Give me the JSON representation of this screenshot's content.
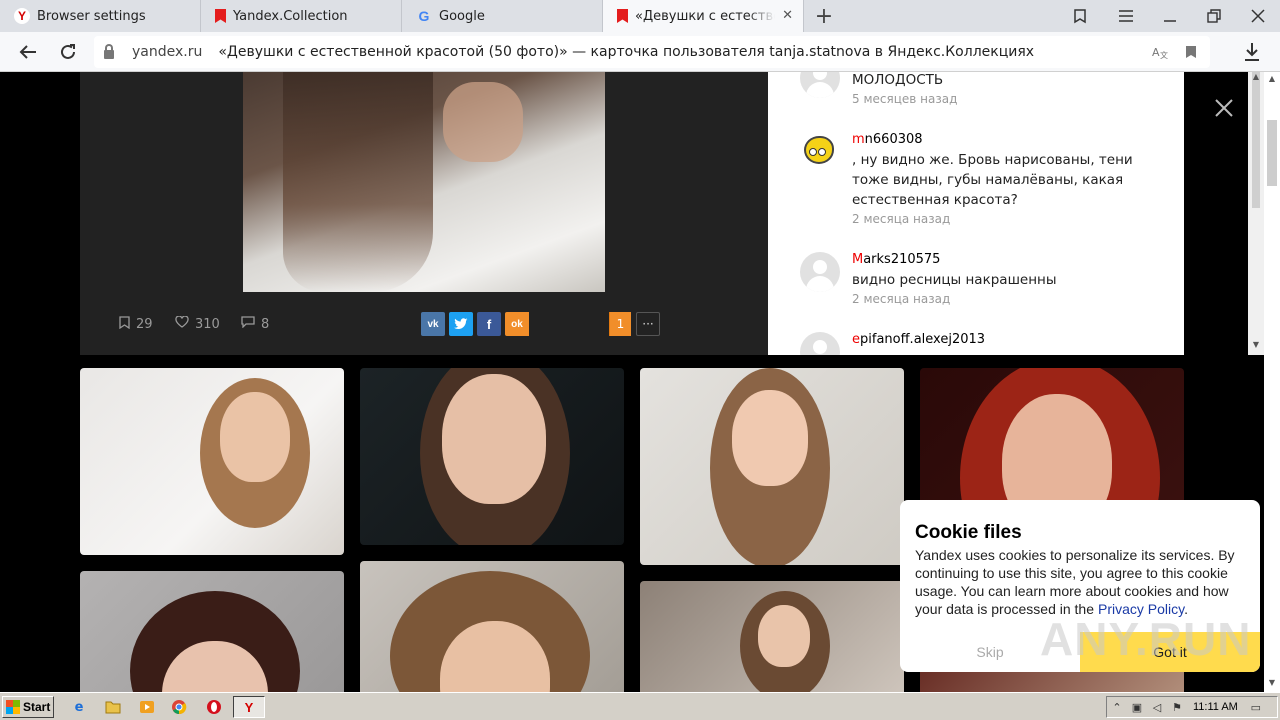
{
  "browser": {
    "tabs": [
      {
        "label": "Browser settings",
        "icon": "yandex-y-icon"
      },
      {
        "label": "Yandex.Collection",
        "icon": "bookmark-icon"
      },
      {
        "label": "Google",
        "icon": "google-g-icon"
      },
      {
        "label": "«Девушки с естественной красотой (50 фото)»",
        "icon": "bookmark-icon",
        "active": true
      }
    ],
    "close_tab_glyph": "✕",
    "new_tab_glyph": "+",
    "address": {
      "domain": "yandex.ru",
      "title": "«Девушки с естественной красотой (50 фото)» — карточка пользователя tanja.statnova в Яндекс.Коллекциях"
    }
  },
  "card": {
    "stats": {
      "bookmarks": "29",
      "likes": "310",
      "comments": "8"
    },
    "share": {
      "vk": "vk",
      "twitter": "t",
      "facebook": "f",
      "ok": "ok",
      "ok_count": "1",
      "more": "···"
    },
    "comments": [
      {
        "author_first": "",
        "author_rest": "",
        "text": "МОЛОДОСТЬ",
        "time": "5 месяцев назад"
      },
      {
        "author_first": "m",
        "author_rest": "n660308",
        "text": ", ну видно же. Бровь нарисованы, тени тоже видны, губы намалёваны, какая естественная красота?",
        "time": "2 месяца назад"
      },
      {
        "author_first": "M",
        "author_rest": "arks210575",
        "text": "видно ресницы накрашенны",
        "time": "2 месяца назад"
      },
      {
        "author_first": "e",
        "author_rest": "pifanoff.alexej2013",
        "text": "",
        "time": ""
      }
    ]
  },
  "cookie": {
    "title": "Cookie files",
    "body": "Yandex uses cookies to personalize its services. By continuing to use this site, you agree to this cookie usage. You can learn more about cookies and how your data is processed in the",
    "link": "Privacy Policy",
    "after_link": ".",
    "skip": "Skip",
    "accept": "Got it"
  },
  "watermark": "ANY.RUN",
  "taskbar": {
    "start": "Start",
    "clock": "11:11 AM"
  },
  "colors": {
    "accent_yellow": "#ffdb4d",
    "username_red": "#ee0000",
    "vk": "#4a76a8",
    "twitter": "#1da1f2",
    "facebook": "#3b5998",
    "ok": "#f18e2a"
  }
}
